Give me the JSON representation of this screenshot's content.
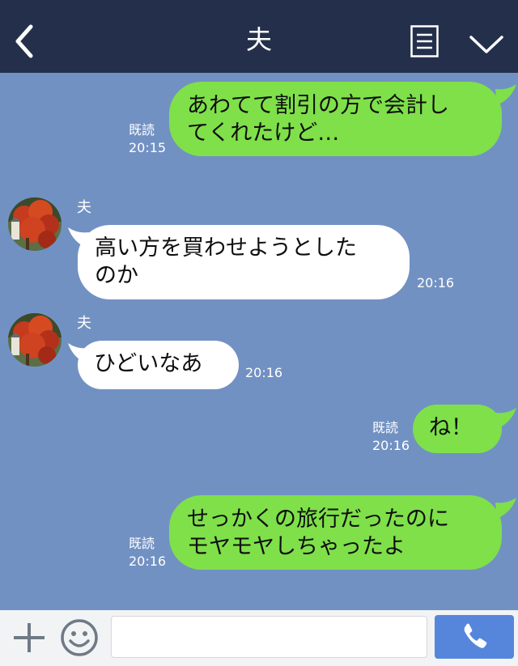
{
  "header": {
    "title": "夫"
  },
  "messages": [
    {
      "side": "out",
      "lines": [
        "あわてて割引の方で会計し",
        "てくれたけど…"
      ],
      "read": "既読",
      "time": "20:15"
    },
    {
      "side": "in",
      "sender": "夫",
      "lines": [
        "高い方を買わせようとした",
        "のか"
      ],
      "time": "20:16"
    },
    {
      "side": "in",
      "sender": "夫",
      "lines": [
        "ひどいなあ"
      ],
      "time": "20:16"
    },
    {
      "side": "out",
      "lines": [
        "ね！"
      ],
      "read": "既読",
      "time": "20:16"
    },
    {
      "side": "out",
      "lines": [
        "せっかくの旅行だったのに",
        "モヤモヤしちゃったよ"
      ],
      "read": "既読",
      "time": "20:16"
    }
  ],
  "input": {
    "placeholder": ""
  },
  "icons": {
    "back": "chevron-left-icon",
    "menu": "menu-lines-icon",
    "collapse": "chevron-down-icon",
    "plus": "plus-icon",
    "emoji": "smiley-icon",
    "call": "phone-icon"
  },
  "colors": {
    "header": "#24304b",
    "chat_background": "#7291c3",
    "outgoing_bubble": "#7fe04a",
    "incoming_bubble": "#ffffff",
    "call_button": "#5686dc"
  }
}
